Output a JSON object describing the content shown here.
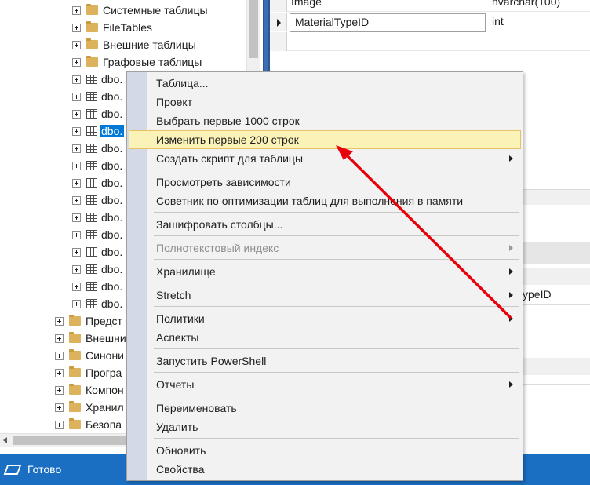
{
  "tree": {
    "items": [
      {
        "kind": "folder",
        "label": "Системные таблицы"
      },
      {
        "kind": "folder",
        "label": "FileTables"
      },
      {
        "kind": "folder",
        "label": "Внешние таблицы"
      },
      {
        "kind": "folder",
        "label": "Графовые таблицы"
      },
      {
        "kind": "table",
        "label": "dbo."
      },
      {
        "kind": "table",
        "label": "dbo."
      },
      {
        "kind": "table",
        "label": "dbo."
      },
      {
        "kind": "table",
        "label": "dbo.",
        "selected": true
      },
      {
        "kind": "table",
        "label": "dbo."
      },
      {
        "kind": "table",
        "label": "dbo."
      },
      {
        "kind": "table",
        "label": "dbo."
      },
      {
        "kind": "table",
        "label": "dbo."
      },
      {
        "kind": "table",
        "label": "dbo."
      },
      {
        "kind": "table",
        "label": "dbo."
      },
      {
        "kind": "table",
        "label": "dbo."
      },
      {
        "kind": "table",
        "label": "dbo."
      },
      {
        "kind": "table",
        "label": "dbo."
      },
      {
        "kind": "table",
        "label": "dbo."
      },
      {
        "kind": "folder",
        "label": "Предст"
      },
      {
        "kind": "folder",
        "label": "Внешни"
      },
      {
        "kind": "folder",
        "label": "Синони"
      },
      {
        "kind": "folder",
        "label": "Програ"
      },
      {
        "kind": "folder",
        "label": "Компон"
      },
      {
        "kind": "folder",
        "label": "Хранил"
      },
      {
        "kind": "folder",
        "label": "Безопа"
      }
    ]
  },
  "designer": {
    "rows": [
      {
        "name": "Image",
        "type": "nvarchar(100)"
      },
      {
        "name": "MaterialTypeID",
        "type": "int",
        "current": true
      },
      {
        "name": "",
        "type": ""
      }
    ]
  },
  "properties": {
    "visible_value": "ypeID"
  },
  "context_menu": {
    "items": [
      {
        "label": "Таблица..."
      },
      {
        "label": "Проект"
      },
      {
        "label": "Выбрать первые 1000 строк"
      },
      {
        "label": "Изменить первые 200 строк",
        "highlighted": true
      },
      {
        "label": "Создать скрипт для таблицы",
        "submenu": true
      },
      {
        "separator": true
      },
      {
        "label": "Просмотреть зависимости"
      },
      {
        "label": "Советник по оптимизации таблиц для выполнения в памяти"
      },
      {
        "separator": true
      },
      {
        "label": "Зашифровать столбцы..."
      },
      {
        "separator": true
      },
      {
        "label": "Полнотекстовый индекс",
        "submenu": true,
        "disabled": true
      },
      {
        "separator": true
      },
      {
        "label": "Хранилище",
        "submenu": true
      },
      {
        "separator": true
      },
      {
        "label": "Stretch",
        "submenu": true
      },
      {
        "separator": true
      },
      {
        "label": "Политики",
        "submenu": true
      },
      {
        "label": "Аспекты"
      },
      {
        "separator": true
      },
      {
        "label": "Запустить PowerShell"
      },
      {
        "separator": true
      },
      {
        "label": "Отчеты",
        "submenu": true
      },
      {
        "separator": true
      },
      {
        "label": "Переименовать"
      },
      {
        "label": "Удалить"
      },
      {
        "separator": true
      },
      {
        "label": "Обновить"
      },
      {
        "label": "Свойства"
      }
    ]
  },
  "statusbar": {
    "text": "Готово"
  },
  "colors": {
    "statusbar": "#1a6fc2",
    "selection": "#0078d7",
    "menu_highlight": "#fbf2b8",
    "annotation_arrow": "#e8000b"
  }
}
